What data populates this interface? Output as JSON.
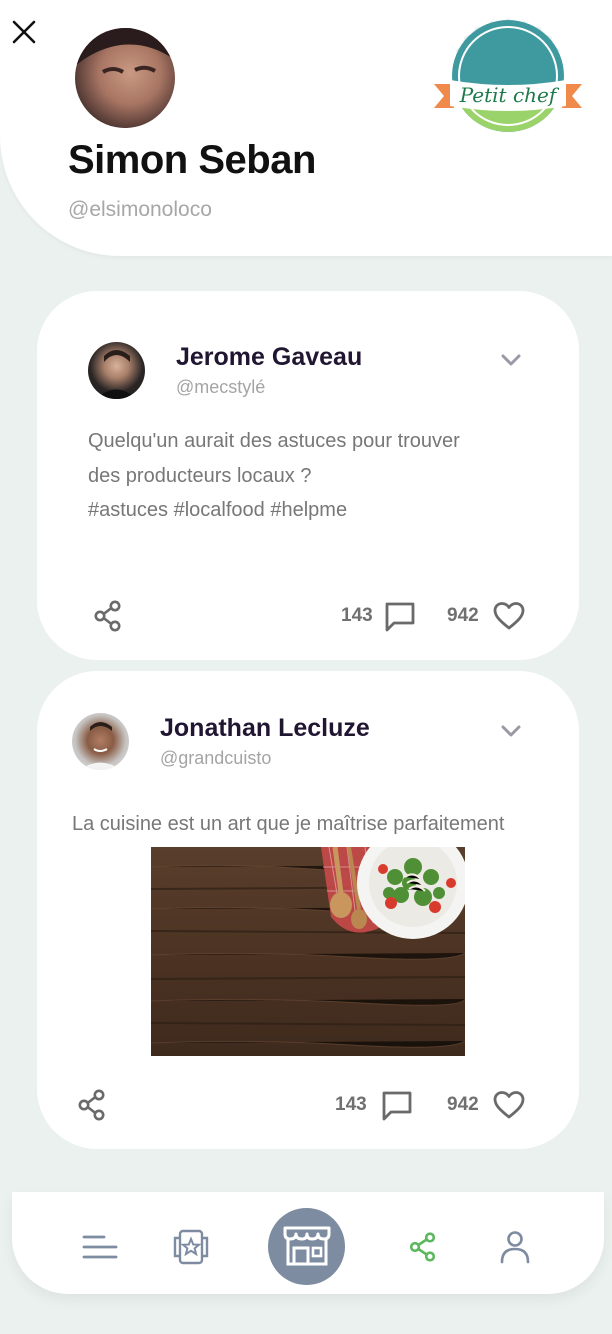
{
  "profile": {
    "name": "Simon Seban",
    "handle": "@elsimonoloco",
    "logo_text": "Petit chef"
  },
  "posts": [
    {
      "author": "Jerome Gaveau",
      "handle": "@mecstylé",
      "text_lines": [
        "Quelqu'un aurait des astuces pour trouver",
        "des producteurs locaux ?",
        "#astuces #localfood #helpme"
      ],
      "comments": "143",
      "likes": "942"
    },
    {
      "author": "Jonathan Lecluze",
      "handle": "@grandcuisto",
      "text_lines": [
        "La cuisine est un art que je maîtrise parfaitement"
      ],
      "comments": "143",
      "likes": "942"
    }
  ],
  "colors": {
    "background": "#ebf1ee",
    "accent_green": "#5cb85c",
    "nav_center": "#7d8ca0",
    "logo_teal": "#3f9aa0",
    "logo_orange": "#f08a4b",
    "logo_green": "#9ad36a"
  },
  "icons": [
    "close-icon",
    "chevron-down-icon",
    "share-icon",
    "comment-icon",
    "heart-icon",
    "menu-icon",
    "favorites-icon",
    "store-icon",
    "user-icon"
  ]
}
